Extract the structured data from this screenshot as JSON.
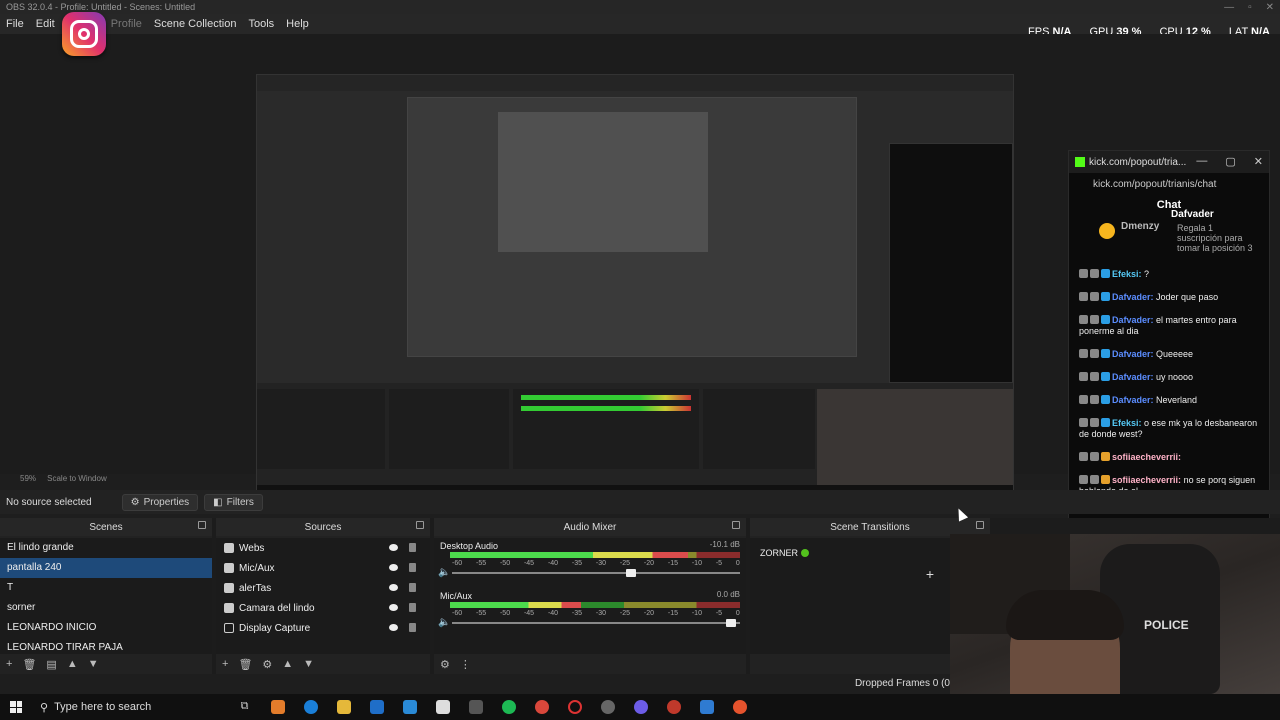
{
  "window": {
    "title": "OBS 32.0.4 - Profile: Untitled - Scenes: Untitled"
  },
  "menu": [
    "File",
    "Edit",
    "Profile",
    "Scene Collection",
    "Tools",
    "Help"
  ],
  "stats": {
    "fps_label": "FPS",
    "fps": "N/A",
    "gpu_label": "GPU",
    "gpu": "39 %",
    "cpu_label": "CPU",
    "cpu": "12 %",
    "lat_label": "LAT",
    "lat": "N/A"
  },
  "preview": {
    "zoom": "59%",
    "scale_mode": "Scale to Window"
  },
  "chat": {
    "url_title": "kick.com/popout/tria...",
    "url": "kick.com/popout/trianis/chat",
    "header": "Chat",
    "pinned": {
      "user": "Dmenzy",
      "gifter": "Dafvader",
      "text": "Regala 1 suscripción para tomar la posición 3"
    },
    "messages": [
      {
        "user": "Efeksi:",
        "text": "?",
        "color": "#55c9f5"
      },
      {
        "user": "Dafvader:",
        "text": "Joder que paso",
        "color": "#5b8dff"
      },
      {
        "user": "Dafvader:",
        "text": "el martes entro para ponerme al dia",
        "color": "#5b8dff"
      },
      {
        "user": "Dafvader:",
        "text": "Queeeee",
        "color": "#5b8dff"
      },
      {
        "user": "Dafvader:",
        "text": "uy noooo",
        "color": "#5b8dff"
      },
      {
        "user": "Dafvader:",
        "text": "Neverland",
        "color": "#5b8dff"
      },
      {
        "user": "Efeksi:",
        "text": "o ese mk ya lo desbanearon de donde west?",
        "color": "#55c9f5"
      },
      {
        "user": "sofiiaecheverrii:",
        "text": "",
        "color": "#ffb3c8"
      },
      {
        "user": "sofiiaecheverrii:",
        "text": "no se porq siguen hablando de el",
        "color": "#ffb3c8"
      }
    ]
  },
  "context_bar": {
    "no_source": "No source selected",
    "properties": "Properties",
    "filters": "Filters"
  },
  "docks": {
    "scenes": {
      "title": "Scenes",
      "items": [
        "El lindo grande",
        "pantalla 240",
        "T",
        "sorner",
        "LEONARDO INICIO",
        "LEONARDO TIRAR PAJA"
      ],
      "selected": 1
    },
    "sources": {
      "title": "Sources",
      "items": [
        {
          "name": "Webs",
          "icon": "globe-icon"
        },
        {
          "name": "Mic/Aux",
          "icon": "mic-icon"
        },
        {
          "name": "alerTas",
          "icon": "globe-icon"
        },
        {
          "name": "Camara del lindo",
          "icon": "camera-icon"
        },
        {
          "name": "Display Capture",
          "icon": "display-icon"
        }
      ]
    },
    "mixer": {
      "title": "Audio Mixer",
      "ticks": [
        "-60",
        "-55",
        "-50",
        "-45",
        "-40",
        "-35",
        "-30",
        "-25",
        "-20",
        "-15",
        "-10",
        "-5",
        "0"
      ],
      "channels": [
        {
          "name": "Desktop Audio",
          "db": "-10.1 dB",
          "level": 0.82,
          "volume": 0.62
        },
        {
          "name": "Mic/Aux",
          "db": "0.0 dB",
          "level": 0.45,
          "volume": 0.97
        }
      ]
    },
    "transitions": {
      "title": "Scene Transitions",
      "item": "ZORNER"
    }
  },
  "status": {
    "dropped_frames": "Dropped Frames 0 (0"
  },
  "taskbar": {
    "search_placeholder": "Type here to search"
  }
}
